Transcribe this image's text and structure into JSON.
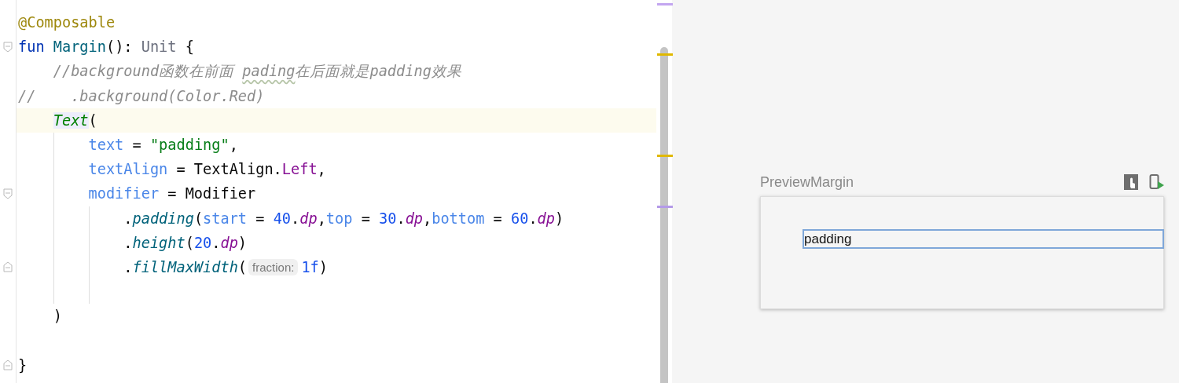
{
  "editor": {
    "lines": [
      {
        "current": false,
        "tokens": [
          {
            "kind": "annotation",
            "text": "@Composable"
          }
        ]
      },
      {
        "current": false,
        "fold_start": true,
        "tokens": [
          {
            "kind": "keyword",
            "text": "fun "
          },
          {
            "kind": "declaration",
            "text": "Margin"
          },
          {
            "kind": "plain",
            "text": "(): "
          },
          {
            "kind": "type",
            "text": "Unit"
          },
          {
            "kind": "plain",
            "text": " {"
          }
        ]
      },
      {
        "current": false,
        "indent": [
          {
            "guide": false
          }
        ],
        "tokens": [
          {
            "kind": "comment",
            "text": "//background函数在前面 "
          },
          {
            "kind": "typo",
            "text": "pading"
          },
          {
            "kind": "comment",
            "text": "在后面就是padding效果"
          }
        ]
      },
      {
        "current": false,
        "tokens": [
          {
            "kind": "comment",
            "text": "//    .background(Color.Red)"
          }
        ]
      },
      {
        "current": true,
        "indent": [
          {
            "guide": false
          }
        ],
        "tokens": [
          {
            "kind": "composable",
            "text": "Text"
          },
          {
            "kind": "plain",
            "text": "("
          }
        ]
      },
      {
        "current": false,
        "indent": [
          {
            "guide": false
          },
          {
            "guide": true
          }
        ],
        "tokens": [
          {
            "kind": "param",
            "text": "text"
          },
          {
            "kind": "plain",
            "text": " = "
          },
          {
            "kind": "string",
            "text": "\"padding\""
          },
          {
            "kind": "plain",
            "text": ","
          }
        ]
      },
      {
        "current": false,
        "indent": [
          {
            "guide": false
          },
          {
            "guide": true
          }
        ],
        "tokens": [
          {
            "kind": "param",
            "text": "textAlign"
          },
          {
            "kind": "plain",
            "text": " = TextAlign."
          },
          {
            "kind": "member",
            "text": "Left"
          },
          {
            "kind": "plain",
            "text": ","
          }
        ]
      },
      {
        "current": false,
        "fold_start": true,
        "indent": [
          {
            "guide": false
          },
          {
            "guide": true
          }
        ],
        "tokens": [
          {
            "kind": "param",
            "text": "modifier"
          },
          {
            "kind": "plain",
            "text": " = Modifier"
          }
        ]
      },
      {
        "current": false,
        "indent": [
          {
            "guide": false
          },
          {
            "guide": true
          },
          {
            "guide": true
          }
        ],
        "tokens": [
          {
            "kind": "plain",
            "text": "."
          },
          {
            "kind": "call",
            "text": "padding"
          },
          {
            "kind": "plain",
            "text": "("
          },
          {
            "kind": "param",
            "text": "start"
          },
          {
            "kind": "plain",
            "text": " = "
          },
          {
            "kind": "number",
            "text": "40"
          },
          {
            "kind": "plain",
            "text": "."
          },
          {
            "kind": "extension",
            "text": "dp"
          },
          {
            "kind": "plain",
            "text": ","
          },
          {
            "kind": "param",
            "text": "top"
          },
          {
            "kind": "plain",
            "text": " = "
          },
          {
            "kind": "number",
            "text": "30"
          },
          {
            "kind": "plain",
            "text": "."
          },
          {
            "kind": "extension",
            "text": "dp"
          },
          {
            "kind": "plain",
            "text": ","
          },
          {
            "kind": "param",
            "text": "bottom"
          },
          {
            "kind": "plain",
            "text": " = "
          },
          {
            "kind": "number",
            "text": "60"
          },
          {
            "kind": "plain",
            "text": "."
          },
          {
            "kind": "extension",
            "text": "dp"
          },
          {
            "kind": "plain",
            "text": ")"
          }
        ]
      },
      {
        "current": false,
        "indent": [
          {
            "guide": false
          },
          {
            "guide": true
          },
          {
            "guide": true
          }
        ],
        "tokens": [
          {
            "kind": "plain",
            "text": "."
          },
          {
            "kind": "call",
            "text": "height"
          },
          {
            "kind": "plain",
            "text": "("
          },
          {
            "kind": "number",
            "text": "20"
          },
          {
            "kind": "plain",
            "text": "."
          },
          {
            "kind": "extension",
            "text": "dp"
          },
          {
            "kind": "plain",
            "text": ")"
          }
        ]
      },
      {
        "current": false,
        "fold_end": true,
        "indent": [
          {
            "guide": false
          },
          {
            "guide": true
          },
          {
            "guide": true
          }
        ],
        "tokens": [
          {
            "kind": "plain",
            "text": "."
          },
          {
            "kind": "call",
            "text": "fillMaxWidth"
          },
          {
            "kind": "plain",
            "text": "("
          },
          {
            "kind": "hint",
            "text": "fraction:"
          },
          {
            "kind": "number",
            "text": "1f"
          },
          {
            "kind": "plain",
            "text": ")"
          }
        ]
      },
      {
        "current": false,
        "indent": [
          {
            "guide": false
          },
          {
            "guide": true
          },
          {
            "guide": true
          }
        ]
      },
      {
        "current": false,
        "indent": [
          {
            "guide": false
          }
        ],
        "tokens": [
          {
            "kind": "plain",
            "text": ")"
          }
        ]
      },
      {
        "current": false
      },
      {
        "current": false,
        "fold_end": true,
        "tokens": [
          {
            "kind": "plain",
            "text": "}"
          }
        ]
      }
    ]
  },
  "preview": {
    "title": "PreviewMargin",
    "text": "padding"
  }
}
